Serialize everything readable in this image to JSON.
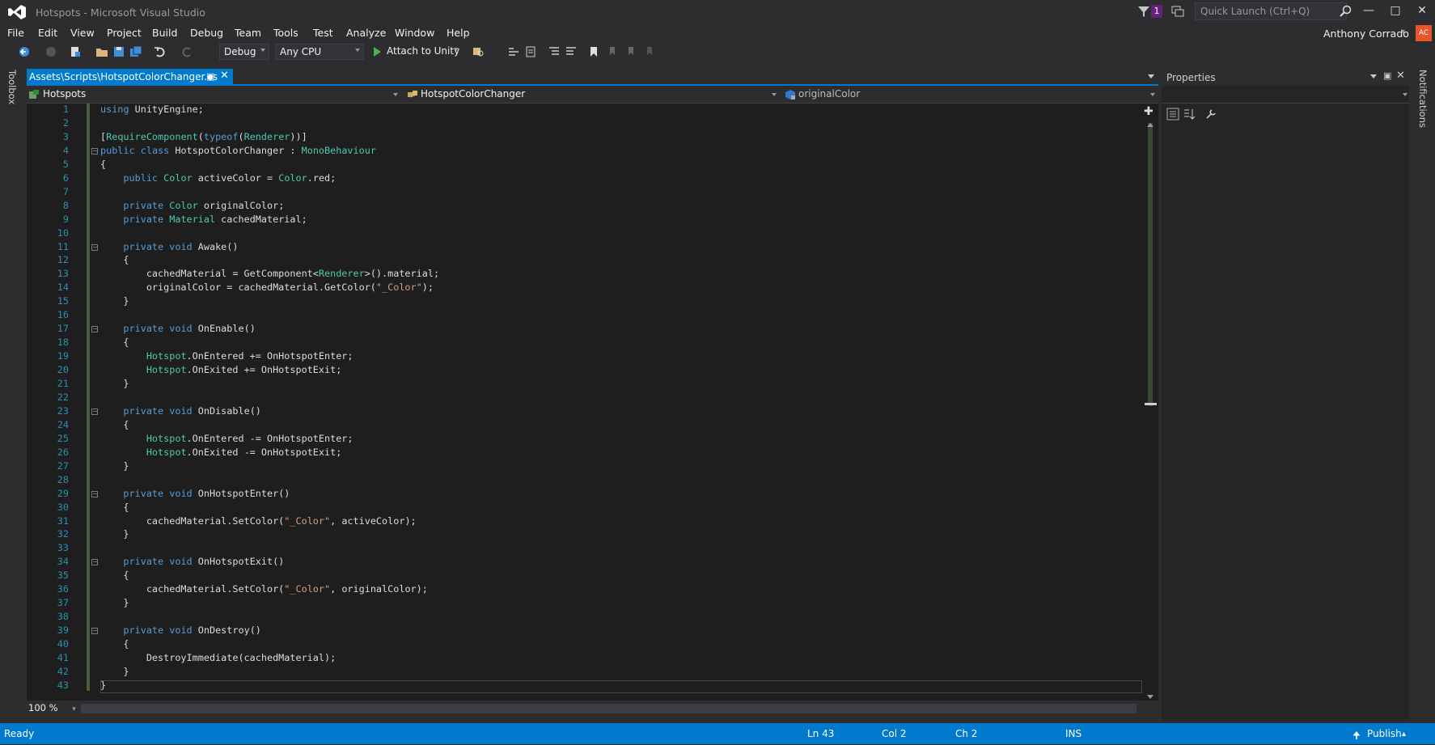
{
  "window": {
    "title": "Hotspots - Microsoft Visual Studio",
    "notification_count": "1",
    "quick_launch_placeholder": "Quick Launch (Ctrl+Q)",
    "user_name": "Anthony Corrado",
    "user_initials": "AC"
  },
  "menu": [
    "File",
    "Edit",
    "View",
    "Project",
    "Build",
    "Debug",
    "Team",
    "Tools",
    "Test",
    "Analyze",
    "Window",
    "Help"
  ],
  "toolbar": {
    "configuration": "Debug",
    "platform": "Any CPU",
    "attach_label": "Attach to Unity"
  },
  "side": {
    "toolbox": "Toolbox",
    "notifications": "Notifications"
  },
  "tab": {
    "label": "Assets\\Scripts\\HotspotColorChanger.cs"
  },
  "nav": {
    "project": "Hotspots",
    "type": "HotspotColorChanger",
    "member": "originalColor"
  },
  "code_lines": [
    "using UnityEngine;",
    "",
    "[RequireComponent(typeof(Renderer))]",
    "public class HotspotColorChanger : MonoBehaviour",
    "{",
    "    public Color activeColor = Color.red;",
    "",
    "    private Color originalColor;",
    "    private Material cachedMaterial;",
    "",
    "    private void Awake()",
    "    {",
    "        cachedMaterial = GetComponent<Renderer>().material;",
    "        originalColor = cachedMaterial.GetColor(\"_Color\");",
    "    }",
    "",
    "    private void OnEnable()",
    "    {",
    "        Hotspot.OnEntered += OnHotspotEnter;",
    "        Hotspot.OnExited += OnHotspotExit;",
    "    }",
    "",
    "    private void OnDisable()",
    "    {",
    "        Hotspot.OnEntered -= OnHotspotEnter;",
    "        Hotspot.OnExited -= OnHotspotExit;",
    "    }",
    "",
    "    private void OnHotspotEnter()",
    "    {",
    "        cachedMaterial.SetColor(\"_Color\", activeColor);",
    "    }",
    "",
    "    private void OnHotspotExit()",
    "    {",
    "        cachedMaterial.SetColor(\"_Color\", originalColor);",
    "    }",
    "",
    "    private void OnDestroy()",
    "    {",
    "        DestroyImmediate(cachedMaterial);",
    "    }",
    "}"
  ],
  "editor": {
    "zoom": "100 %"
  },
  "properties": {
    "title": "Properties"
  },
  "status": {
    "state": "Ready",
    "line": "Ln 43",
    "col": "Col 2",
    "ch": "Ch 2",
    "mode": "INS",
    "publish": "Publish"
  },
  "colors": {
    "accent": "#007acc",
    "keyword": "#569cd6",
    "type": "#4ec9b0",
    "string": "#d69d85",
    "line_number": "#2b91af"
  }
}
